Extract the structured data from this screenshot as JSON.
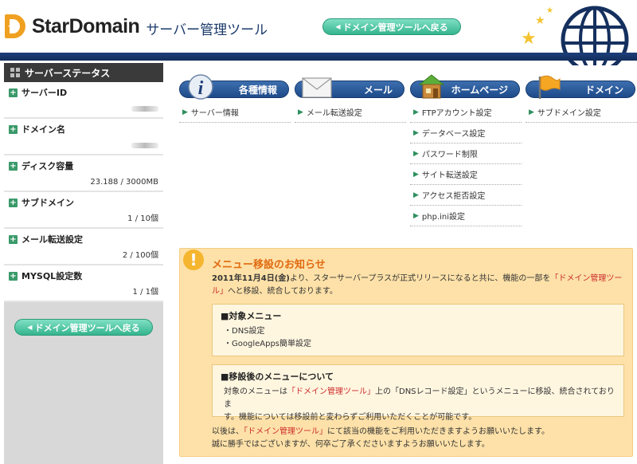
{
  "header": {
    "logo_text": "StarDomain",
    "subtitle": "サーバー管理ツール",
    "back_button": "ドメイン管理ツールへ戻る"
  },
  "sidebar": {
    "title": "サーバーステータス",
    "items": [
      {
        "label": "サーバーID",
        "value": ""
      },
      {
        "label": "ドメイン名",
        "value": ""
      },
      {
        "label": "ディスク容量",
        "value": "23.188 / 3000MB"
      },
      {
        "label": "サブドメイン",
        "value": "1 / 10個"
      },
      {
        "label": "メール転送設定",
        "value": "2 / 100個"
      },
      {
        "label": "MYSQL設定数",
        "value": "1 / 1個"
      }
    ],
    "back_button": "ドメイン管理ツールへ戻る"
  },
  "categories": [
    {
      "title": "各種情報",
      "icon": "info-icon",
      "links": [
        "サーバー情報"
      ]
    },
    {
      "title": "メール",
      "icon": "mail-envelope-icon",
      "links": [
        "メール転送設定"
      ]
    },
    {
      "title": "ホームページ",
      "icon": "house-icon",
      "links": [
        "FTPアカウント設定",
        "データベース設定",
        "パスワード制限",
        "サイト転送設定",
        "アクセス拒否設定",
        "php.ini設定"
      ]
    },
    {
      "title": "ドメイン",
      "icon": "flag-icon",
      "links": [
        "サブドメイン設定"
      ]
    }
  ],
  "notice": {
    "title": "メニュー移設のお知らせ",
    "intro_date": "2011年11月4日(金)",
    "intro_1": "より、スターサーバープラスが正式リリースになると共に、機能の一部を",
    "intro_link": "「ドメイン管理ツール」",
    "intro_2": "へと移設、統合しております。",
    "box1_title": "■対象メニュー",
    "box1_items": [
      "・DNS設定",
      "・GoogleApps簡単設定"
    ],
    "box2_title": "■移設後のメニューについて",
    "box2_text_1": "対象のメニューは",
    "box2_link": "「ドメイン管理ツール」",
    "box2_text_2": "上の「DNSレコード設定」というメニューに移設、統合されておりま",
    "box2_text_3": "す。機能については移設前と変わらずご利用いただくことが可能です。",
    "foot_1": "以後は、",
    "foot_link": "「ドメイン管理ツール」",
    "foot_2": "にて該当の機能をご利用いただきますようお願いいたします。",
    "foot_3": "誠に勝手ではございますが、何卒ご了承くださいますようお願いいたします。"
  },
  "colors": {
    "brand_navy": "#1c3f7a",
    "accent_green": "#35b48e",
    "notice_bg": "#fde1a8",
    "notice_title": "#e06a10",
    "link_red": "#cc2a2a"
  }
}
